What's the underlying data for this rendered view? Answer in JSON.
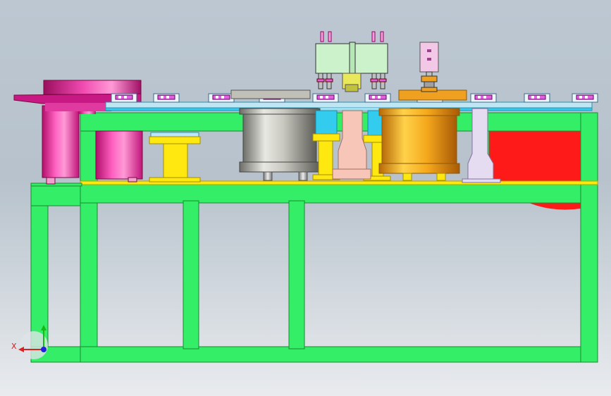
{
  "viewport": {
    "background_top": "#bcc7d2",
    "background_bottom": "#e9ebee"
  },
  "colors": {
    "frame_green": "#33ee66",
    "frame_outline": "#1a8a33",
    "plate_cyan": "#33ccee",
    "plate_light": "#bfe6f2",
    "feeder_magenta": "#e6208c",
    "feeder_light": "#ff80c8",
    "support_yellow": "#ffe810",
    "cylinder_gray": "#b8b8b0",
    "cylinder_orange": "#f0a020",
    "guard_red": "#ff1a1a",
    "block_pink": "#f7c6b8",
    "block_lavender": "#e6dcf2",
    "module_mint": "#ccf2cc",
    "fixture_pink": "#e060e0",
    "actuator_pink": "#f2c8e6"
  },
  "axis_triad": {
    "x_label": "X",
    "x_icon": "x-axis-arrow-icon",
    "y_icon": "y-axis-arrow-icon",
    "z_icon": "z-axis-dot-icon"
  }
}
